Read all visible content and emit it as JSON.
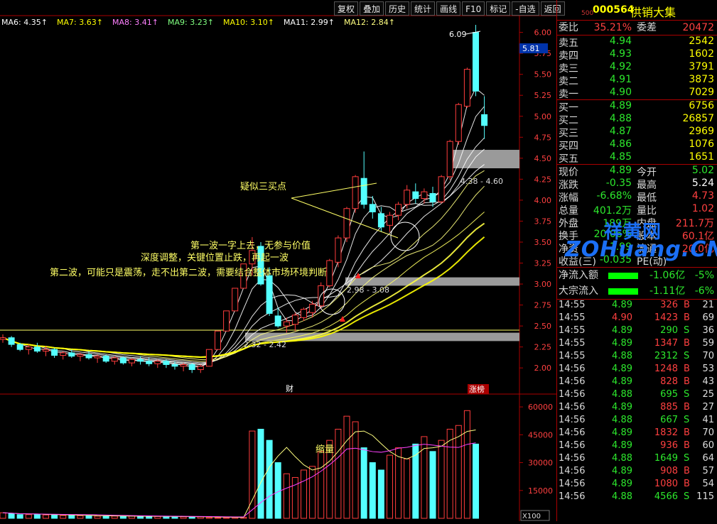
{
  "toolbar": [
    {
      "label": "复权"
    },
    {
      "label": "叠加"
    },
    {
      "label": "历史"
    },
    {
      "label": "统计"
    },
    {
      "label": "画线"
    },
    {
      "label": "F10"
    },
    {
      "label": "标记"
    },
    {
      "label": "-自选"
    },
    {
      "label": "返回"
    }
  ],
  "ma_legend": [
    "MA6: 4.35↑",
    "MA7: 3.63↑",
    "MA8: 3.41↑",
    "MA9: 3.23↑",
    "MA10: 3.10↑",
    "MA11: 2.99↑",
    "MA12: 2.84↑"
  ],
  "price_axis": {
    "labels": [
      "6.00",
      "5.75",
      "5.50",
      "5.25",
      "5.00",
      "4.75",
      "4.50",
      "4.25",
      "4.00",
      "3.75",
      "3.50",
      "3.25",
      "3.00",
      "2.75",
      "2.50",
      "2.25",
      "2.00"
    ],
    "current": "5.81"
  },
  "volume_axis": {
    "labels": [
      "60000",
      "45000",
      "30000",
      "15000"
    ],
    "unit": "X100"
  },
  "annotations": {
    "high_label": "6.09",
    "suspect_buy": "疑似三买点",
    "wave1": "第一波一字上去，无参与价值",
    "adjust": "深度调整，关键位置止跌，再起一波",
    "wave2": "第二波，可能只是震荡，走不出第二波，需要结合整体市场环境判断",
    "zone_top": "4.38 - 4.60",
    "zone_mid": "2.98 - 3.08",
    "zone_low": "2.32 - 2.42",
    "shrink": "缩量",
    "cai": "财",
    "zhangbang": "涨榜"
  },
  "stock": {
    "market": "500",
    "code": "000564",
    "name": "供销大集"
  },
  "weibi": {
    "l1": "委比",
    "v1": "35.21%",
    "l2": "委差",
    "v2": "20472"
  },
  "sells": [
    {
      "label": "卖五",
      "price": "4.94",
      "vol": "2542"
    },
    {
      "label": "卖四",
      "price": "4.93",
      "vol": "1602"
    },
    {
      "label": "卖三",
      "price": "4.92",
      "vol": "3791"
    },
    {
      "label": "卖二",
      "price": "4.91",
      "vol": "3873"
    },
    {
      "label": "卖一",
      "price": "4.90",
      "vol": "7029"
    }
  ],
  "buys": [
    {
      "label": "买一",
      "price": "4.89",
      "vol": "6756"
    },
    {
      "label": "买二",
      "price": "4.88",
      "vol": "26857"
    },
    {
      "label": "买三",
      "price": "4.87",
      "vol": "2969"
    },
    {
      "label": "买四",
      "price": "4.86",
      "vol": "1076"
    },
    {
      "label": "买五",
      "price": "4.85",
      "vol": "1651"
    }
  ],
  "quote": [
    {
      "l1": "现价",
      "v1": "4.89",
      "l2": "今开",
      "v2": "5.02"
    },
    {
      "l1": "涨跌",
      "v1": "-0.35",
      "l2": "最高",
      "v2": "5.24"
    },
    {
      "l1": "涨幅",
      "v1": "-6.68%",
      "l2": "最低",
      "v2": "4.73"
    },
    {
      "l1": "总量",
      "v1": "401.2万",
      "l2": "量比",
      "v2": "1.02"
    },
    {
      "l1": "外盘",
      "v1": "189万",
      "l2": "内盘",
      "v2": "211.7万"
    },
    {
      "l1": "换手",
      "v1": "20.06%",
      "l2": "股本",
      "v2": "60.1亿"
    },
    {
      "l1": "净资",
      "v1": "1.99",
      "l2": "流通",
      "v2": "20.0亿"
    },
    {
      "l1": "收益(三)",
      "v1": "-0.035",
      "l2": "PE(动)",
      "v2": ""
    }
  ],
  "flows": [
    {
      "label": "净流入额",
      "value": "-1.06亿",
      "pct": "-5%"
    },
    {
      "label": "大宗流入",
      "value": "-1.11亿",
      "pct": "-6%"
    }
  ],
  "ticks": [
    {
      "t": "14:55",
      "p": "4.89",
      "v": "326",
      "s": "B",
      "n": "21"
    },
    {
      "t": "14:55",
      "p": "4.90",
      "v": "1423",
      "s": "B",
      "n": "69"
    },
    {
      "t": "14:55",
      "p": "4.89",
      "v": "290",
      "s": "S",
      "n": "36"
    },
    {
      "t": "14:55",
      "p": "4.89",
      "v": "1347",
      "s": "B",
      "n": "59"
    },
    {
      "t": "14:55",
      "p": "4.88",
      "v": "2312",
      "s": "S",
      "n": "70"
    },
    {
      "t": "14:56",
      "p": "4.89",
      "v": "1248",
      "s": "B",
      "n": "53"
    },
    {
      "t": "14:56",
      "p": "4.89",
      "v": "828",
      "s": "B",
      "n": "43"
    },
    {
      "t": "14:56",
      "p": "4.88",
      "v": "695",
      "s": "S",
      "n": "25"
    },
    {
      "t": "14:56",
      "p": "4.89",
      "v": "885",
      "s": "B",
      "n": "27"
    },
    {
      "t": "14:56",
      "p": "4.88",
      "v": "667",
      "s": "S",
      "n": "41"
    },
    {
      "t": "14:56",
      "p": "4.89",
      "v": "1832",
      "s": "B",
      "n": "70"
    },
    {
      "t": "14:56",
      "p": "4.89",
      "v": "936",
      "s": "B",
      "n": "60"
    },
    {
      "t": "14:56",
      "p": "4.88",
      "v": "1649",
      "s": "S",
      "n": "64"
    },
    {
      "t": "14:56",
      "p": "4.89",
      "v": "908",
      "s": "B",
      "n": "57"
    },
    {
      "t": "14:56",
      "p": "4.89",
      "v": "1080",
      "s": "B",
      "n": "54"
    },
    {
      "t": "14:56",
      "p": "4.88",
      "v": "4566",
      "s": "S",
      "n": "115"
    }
  ],
  "watermark": {
    "en": "ZOHuang.CN",
    "cn": "祥黄网"
  },
  "chart_data": {
    "type": "candlestick",
    "ylim": [
      1.9,
      6.2
    ],
    "candles": [
      {
        "o": 2.34,
        "h": 2.4,
        "l": 2.3,
        "c": 2.36
      },
      {
        "o": 2.36,
        "h": 2.38,
        "l": 2.25,
        "c": 2.28
      },
      {
        "o": 2.28,
        "h": 2.3,
        "l": 2.2,
        "c": 2.22
      },
      {
        "o": 2.22,
        "h": 2.28,
        "l": 2.16,
        "c": 2.25
      },
      {
        "o": 2.25,
        "h": 2.3,
        "l": 2.18,
        "c": 2.2
      },
      {
        "o": 2.2,
        "h": 2.26,
        "l": 2.14,
        "c": 2.22
      },
      {
        "o": 2.22,
        "h": 2.24,
        "l": 2.12,
        "c": 2.15
      },
      {
        "o": 2.15,
        "h": 2.2,
        "l": 2.1,
        "c": 2.18
      },
      {
        "o": 2.18,
        "h": 2.22,
        "l": 2.12,
        "c": 2.14
      },
      {
        "o": 2.14,
        "h": 2.18,
        "l": 2.08,
        "c": 2.16
      },
      {
        "o": 2.16,
        "h": 2.2,
        "l": 2.1,
        "c": 2.12
      },
      {
        "o": 2.12,
        "h": 2.16,
        "l": 2.06,
        "c": 2.14
      },
      {
        "o": 2.14,
        "h": 2.16,
        "l": 2.06,
        "c": 2.08
      },
      {
        "o": 2.08,
        "h": 2.14,
        "l": 2.04,
        "c": 2.12
      },
      {
        "o": 2.12,
        "h": 2.14,
        "l": 2.04,
        "c": 2.06
      },
      {
        "o": 2.06,
        "h": 2.12,
        "l": 2.02,
        "c": 2.1
      },
      {
        "o": 2.1,
        "h": 2.14,
        "l": 2.04,
        "c": 2.08
      },
      {
        "o": 2.08,
        "h": 2.12,
        "l": 2.02,
        "c": 2.05
      },
      {
        "o": 2.05,
        "h": 2.1,
        "l": 2.0,
        "c": 2.08
      },
      {
        "o": 2.08,
        "h": 2.1,
        "l": 2.0,
        "c": 2.04
      },
      {
        "o": 2.04,
        "h": 2.08,
        "l": 1.98,
        "c": 2.02
      },
      {
        "o": 2.02,
        "h": 2.06,
        "l": 1.96,
        "c": 2.04
      },
      {
        "o": 2.04,
        "h": 2.06,
        "l": 1.94,
        "c": 1.98
      },
      {
        "o": 1.98,
        "h": 2.04,
        "l": 1.94,
        "c": 2.02
      },
      {
        "o": 2.02,
        "h": 2.22,
        "l": 2.02,
        "c": 2.22
      },
      {
        "o": 2.22,
        "h": 2.44,
        "l": 2.22,
        "c": 2.44
      },
      {
        "o": 2.44,
        "h": 2.68,
        "l": 2.44,
        "c": 2.68
      },
      {
        "o": 2.68,
        "h": 2.95,
        "l": 2.68,
        "c": 2.95
      },
      {
        "o": 2.95,
        "h": 3.24,
        "l": 2.95,
        "c": 3.24
      },
      {
        "o": 3.24,
        "h": 3.56,
        "l": 3.1,
        "c": 3.4
      },
      {
        "o": 3.45,
        "h": 3.5,
        "l": 2.98,
        "c": 3.0
      },
      {
        "o": 3.1,
        "h": 3.2,
        "l": 2.62,
        "c": 2.65
      },
      {
        "o": 2.62,
        "h": 2.72,
        "l": 2.48,
        "c": 2.5
      },
      {
        "o": 2.5,
        "h": 2.6,
        "l": 2.42,
        "c": 2.55
      },
      {
        "o": 2.52,
        "h": 2.66,
        "l": 2.44,
        "c": 2.63
      },
      {
        "o": 2.6,
        "h": 2.72,
        "l": 2.56,
        "c": 2.7
      },
      {
        "o": 2.66,
        "h": 2.8,
        "l": 2.6,
        "c": 2.76
      },
      {
        "o": 2.74,
        "h": 3.02,
        "l": 2.7,
        "c": 2.98
      },
      {
        "o": 2.98,
        "h": 3.3,
        "l": 2.96,
        "c": 3.28
      },
      {
        "o": 3.26,
        "h": 3.58,
        "l": 3.2,
        "c": 3.55
      },
      {
        "o": 3.55,
        "h": 3.92,
        "l": 3.5,
        "c": 3.9
      },
      {
        "o": 3.9,
        "h": 4.3,
        "l": 3.85,
        "c": 4.28
      },
      {
        "o": 4.26,
        "h": 4.58,
        "l": 3.9,
        "c": 3.95
      },
      {
        "o": 3.95,
        "h": 4.05,
        "l": 3.78,
        "c": 3.86
      },
      {
        "o": 3.84,
        "h": 3.92,
        "l": 3.62,
        "c": 3.68
      },
      {
        "o": 3.7,
        "h": 3.86,
        "l": 3.62,
        "c": 3.82
      },
      {
        "o": 3.82,
        "h": 3.98,
        "l": 3.76,
        "c": 3.95
      },
      {
        "o": 3.95,
        "h": 4.18,
        "l": 3.9,
        "c": 4.12
      },
      {
        "o": 4.1,
        "h": 4.2,
        "l": 3.96,
        "c": 4.02
      },
      {
        "o": 4.02,
        "h": 4.14,
        "l": 3.96,
        "c": 4.1
      },
      {
        "o": 4.08,
        "h": 4.16,
        "l": 3.92,
        "c": 3.98
      },
      {
        "o": 3.98,
        "h": 4.3,
        "l": 3.96,
        "c": 4.28
      },
      {
        "o": 4.28,
        "h": 4.72,
        "l": 4.24,
        "c": 4.7
      },
      {
        "o": 4.7,
        "h": 5.16,
        "l": 4.66,
        "c": 5.14
      },
      {
        "o": 5.12,
        "h": 5.58,
        "l": 5.1,
        "c": 5.56
      },
      {
        "o": 6.0,
        "h": 6.09,
        "l": 5.24,
        "c": 5.3
      },
      {
        "o": 5.02,
        "h": 5.24,
        "l": 4.73,
        "c": 4.89
      }
    ],
    "volume": [
      3,
      2.5,
      2,
      2,
      2.2,
      1.8,
      2,
      1.5,
      1.6,
      1.4,
      1.5,
      1.2,
      1.3,
      1.2,
      1.1,
      1.2,
      1,
      1.1,
      1,
      0.9,
      1,
      0.8,
      0.9,
      0.8,
      0.5,
      0.4,
      0.4,
      0.5,
      0.6,
      47,
      48,
      42,
      30,
      24,
      22,
      26,
      28,
      36,
      42,
      48,
      55,
      52,
      38,
      30,
      26,
      34,
      38,
      32,
      40,
      44,
      36,
      42,
      48,
      50,
      58,
      40
    ]
  }
}
